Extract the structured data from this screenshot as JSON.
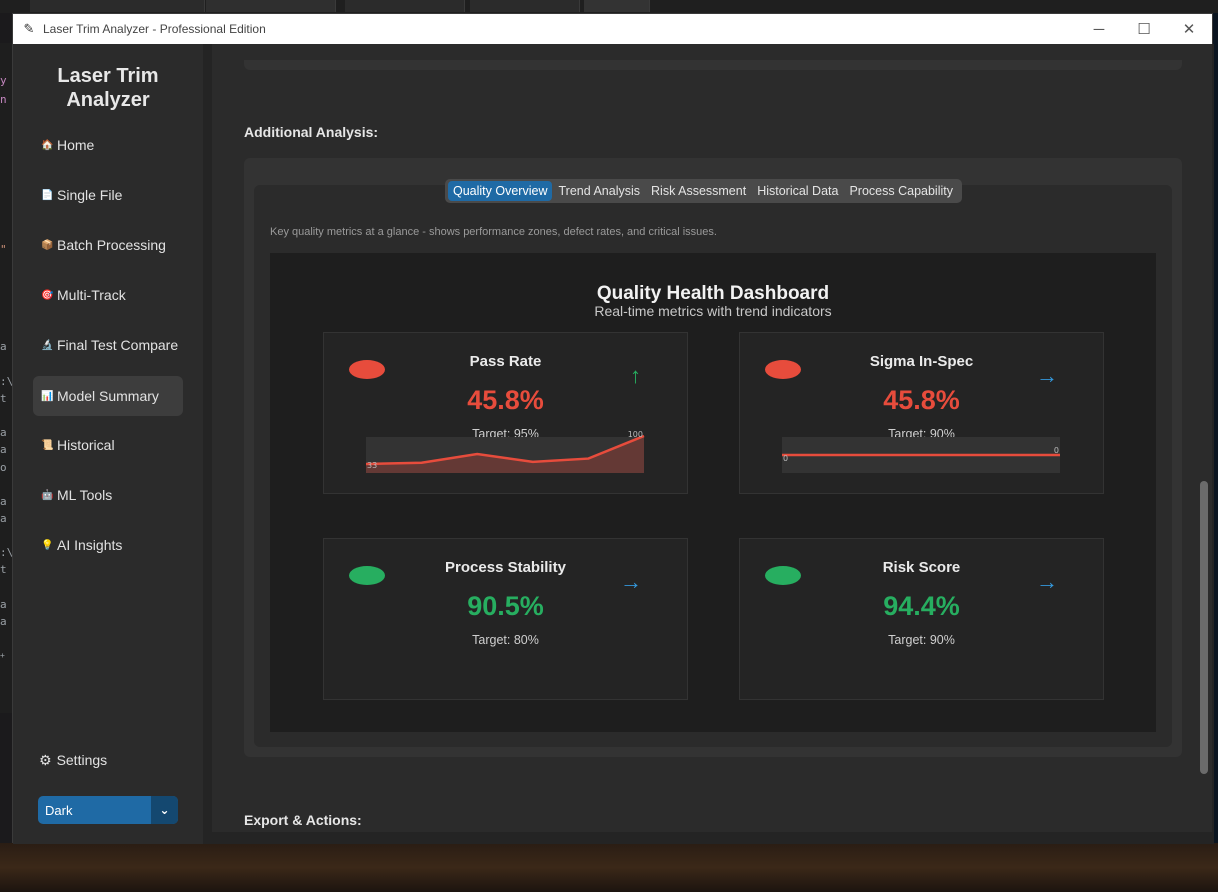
{
  "window": {
    "title": "Laser Trim Analyzer - Professional Edition",
    "controls": {
      "minimize": "─",
      "maximize": "☐",
      "close": "✕"
    }
  },
  "sidebar": {
    "logo_line1": "Laser Trim",
    "logo_line2": "Analyzer",
    "items": [
      {
        "label": "Home",
        "icon": "🏠"
      },
      {
        "label": "Single File",
        "icon": "📄"
      },
      {
        "label": "Batch Processing",
        "icon": "📦"
      },
      {
        "label": "Multi-Track",
        "icon": "🎯"
      },
      {
        "label": "Final Test Compare",
        "icon": "🔬"
      },
      {
        "label": "Model Summary",
        "icon": "📊"
      },
      {
        "label": "Historical",
        "icon": "📜"
      },
      {
        "label": "ML Tools",
        "icon": "🤖"
      },
      {
        "label": "AI Insights",
        "icon": "💡"
      }
    ],
    "active_item": "Model Summary",
    "settings_label": "Settings",
    "settings_icon": "⚙",
    "theme_value": "Dark",
    "theme_arrow": "⌄"
  },
  "main": {
    "additional_analysis_title": "Additional Analysis:",
    "export_title": "Export & Actions:",
    "tabs": [
      {
        "label": "Quality Overview",
        "active": true
      },
      {
        "label": "Trend Analysis",
        "active": false
      },
      {
        "label": "Risk Assessment",
        "active": false
      },
      {
        "label": "Historical Data",
        "active": false
      },
      {
        "label": "Process Capability",
        "active": false
      }
    ],
    "tab_description": "Key quality metrics at a glance - shows performance zones, defect rates, and critical issues."
  },
  "dashboard": {
    "title": "Quality Health Dashboard",
    "subtitle": "Real-time metrics with trend indicators",
    "cards": [
      {
        "label": "Pass Rate",
        "value": "45.8%",
        "target": "Target: 95%",
        "status_color": "#e74c3c",
        "value_color": "#e74c3c",
        "trend": "↑",
        "trend_color": "#27ae60",
        "sparkline": {
          "values": [
            33,
            36,
            57,
            38,
            46,
            100
          ],
          "min_label": "33",
          "max_label": "100"
        }
      },
      {
        "label": "Sigma In-Spec",
        "value": "45.8%",
        "target": "Target: 90%",
        "status_color": "#e74c3c",
        "value_color": "#e74c3c",
        "trend": "→",
        "trend_color": "#3498db",
        "sparkline": {
          "values": [
            0,
            0,
            0,
            0,
            0,
            0
          ],
          "min_label": "0",
          "max_label": "0"
        }
      },
      {
        "label": "Process Stability",
        "value": "90.5%",
        "target": "Target: 80%",
        "status_color": "#27ae60",
        "value_color": "#27ae60",
        "trend": "→",
        "trend_color": "#3498db"
      },
      {
        "label": "Risk Score",
        "value": "94.4%",
        "target": "Target: 90%",
        "status_color": "#27ae60",
        "value_color": "#27ae60",
        "trend": "→",
        "trend_color": "#3498db"
      }
    ]
  }
}
